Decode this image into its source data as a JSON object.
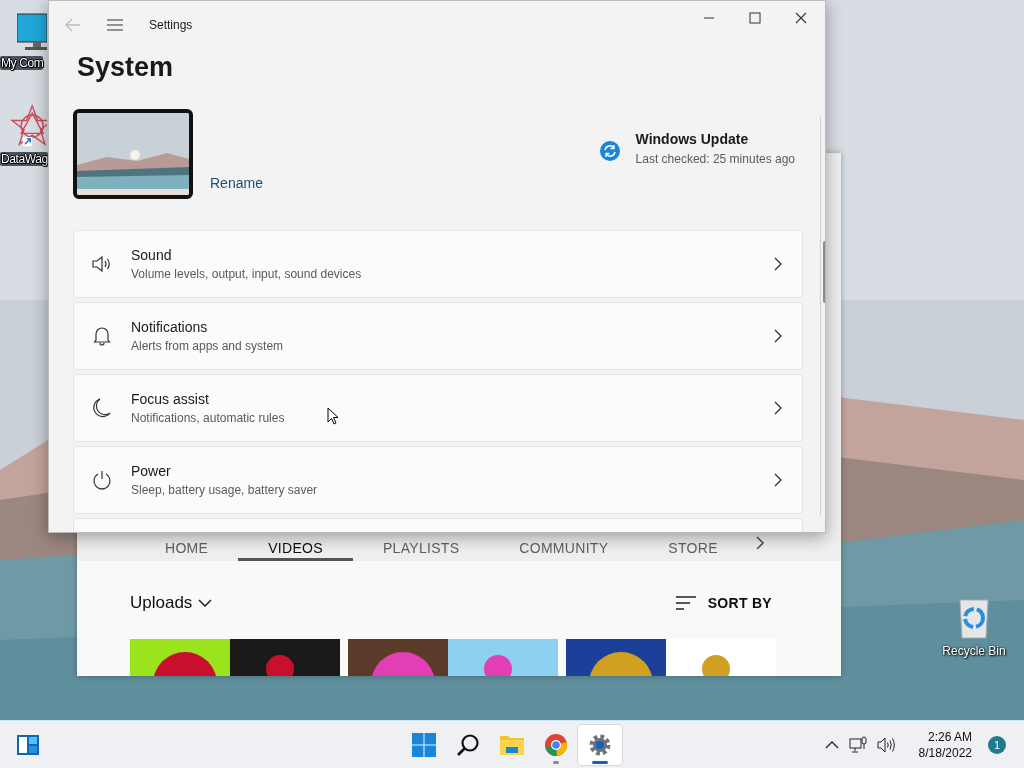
{
  "desktop": {
    "icons": [
      {
        "kind": "monitor",
        "label": "My Com"
      },
      {
        "kind": "app",
        "label": "DataWag"
      },
      {
        "kind": "recycle",
        "label": "Recycle Bin"
      }
    ]
  },
  "browser_window": {
    "tabs": [
      {
        "label": "HOME",
        "selected": false
      },
      {
        "label": "VIDEOS",
        "selected": true
      },
      {
        "label": "PLAYLISTS",
        "selected": false
      },
      {
        "label": "COMMUNITY",
        "selected": false
      },
      {
        "label": "STORE",
        "selected": false
      }
    ],
    "filter": "Uploads",
    "sort": "SORT BY"
  },
  "settings_window": {
    "title": "Settings",
    "heading": "System",
    "rename": "Rename",
    "update": {
      "title": "Windows Update",
      "subtitle": "Last checked: 25 minutes ago"
    },
    "items": [
      {
        "kind": "sound",
        "title": "Sound",
        "subtitle": "Volume levels, output, input, sound devices"
      },
      {
        "kind": "notifications",
        "title": "Notifications",
        "subtitle": "Alerts from apps and system"
      },
      {
        "kind": "focus",
        "title": "Focus assist",
        "subtitle": "Notifications, automatic rules"
      },
      {
        "kind": "power",
        "title": "Power",
        "subtitle": "Sleep, battery usage, battery saver"
      }
    ]
  },
  "taskbar": {
    "apps": [
      {
        "kind": "start",
        "open": false,
        "selected": false
      },
      {
        "kind": "search",
        "open": false,
        "selected": false
      },
      {
        "kind": "explorer",
        "open": false,
        "selected": false
      },
      {
        "kind": "browser",
        "open": true,
        "selected": false
      },
      {
        "kind": "settings",
        "open": true,
        "selected": true
      }
    ],
    "time": "2:26 AM",
    "date": "8/18/2022",
    "notifications": "1"
  }
}
